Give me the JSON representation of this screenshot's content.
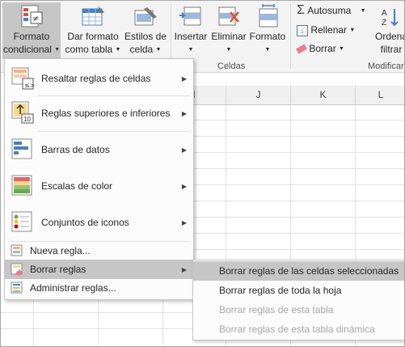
{
  "ribbon": {
    "conditional_format": {
      "line1": "Formato",
      "line2": "condicional"
    },
    "table_format": {
      "line1": "Dar formato",
      "line2": "como tabla"
    },
    "cell_styles": {
      "line1": "Estilos de",
      "line2": "celda"
    },
    "insert": "Insertar",
    "delete": "Eliminar",
    "format": "Formato",
    "cells_group": "Celdas",
    "autosum": "Autosuma",
    "fill": "Rellenar",
    "clear": "Borrar",
    "sort": {
      "line1": "Ordena",
      "line2": "filtrar"
    },
    "modify_group": "Modificar"
  },
  "sheet": {
    "columns": [
      "I",
      "J",
      "K",
      "L"
    ]
  },
  "menu": {
    "items": [
      {
        "label": "Resaltar reglas de celdas"
      },
      {
        "label": "Reglas superiores e inferiores"
      },
      {
        "label": "Barras de datos"
      },
      {
        "label": "Escalas de color"
      },
      {
        "label": "Conjuntos de iconos"
      },
      {
        "label": "Nueva regla..."
      },
      {
        "label": "Borrar reglas"
      },
      {
        "label": "Administrar reglas..."
      }
    ]
  },
  "submenu": {
    "items": [
      {
        "label": "Borrar reglas de las celdas seleccionadas"
      },
      {
        "label": "Borrar reglas de toda la hoja"
      },
      {
        "label": "Borrar reglas de esta tabla"
      },
      {
        "label": "Borrar reglas de esta tabla dinámica"
      }
    ]
  }
}
